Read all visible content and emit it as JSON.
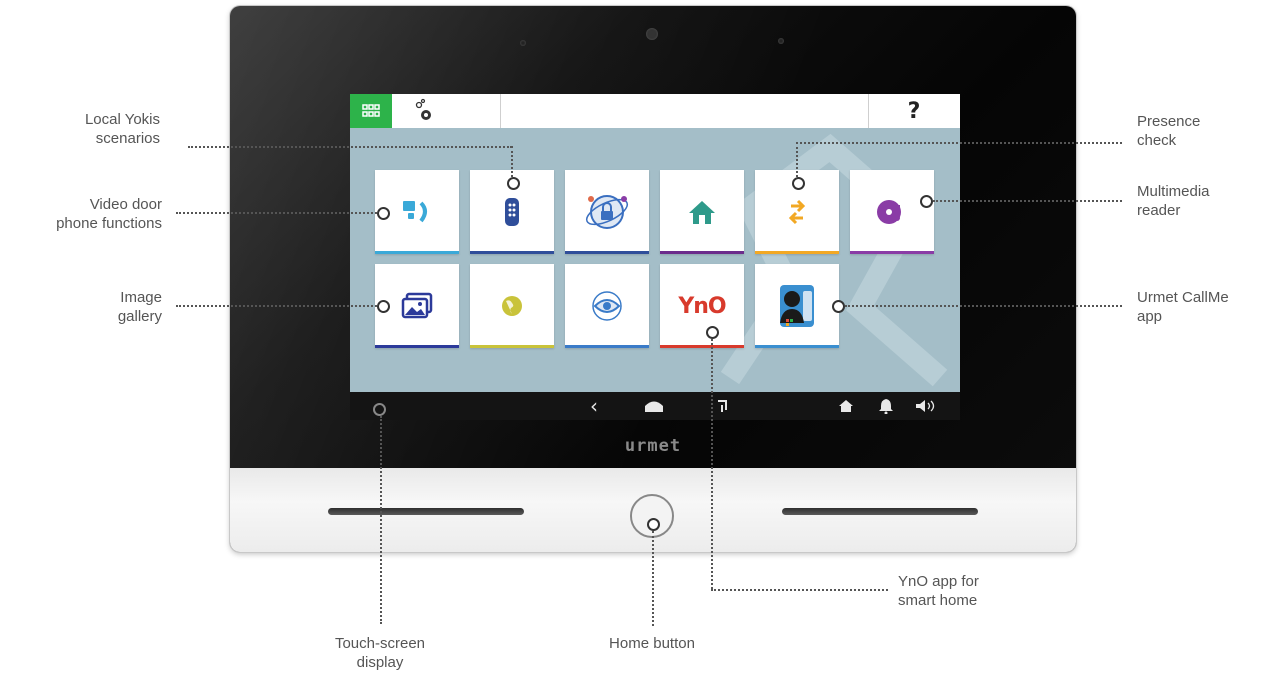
{
  "brand": "urmet",
  "screen": {
    "help_label": "?",
    "nav": {
      "back": "‹",
      "home": "⌂",
      "recent": "⌝"
    },
    "tiles": [
      {
        "name": "video-door-phone-tile",
        "icon": "door-phone-icon",
        "bar_color": "#3aa9d8"
      },
      {
        "name": "yokis-remote-tile",
        "icon": "remote-control-icon",
        "bar_color": "#2f4e9a"
      },
      {
        "name": "security-tile",
        "icon": "padlock-orbit-icon",
        "bar_color": "#2f4e9a"
      },
      {
        "name": "home-tile",
        "icon": "house-icon",
        "bar_color": "#6c2c8c"
      },
      {
        "name": "presence-check-tile",
        "icon": "arrows-exchange-icon",
        "bar_color": "#f2a824"
      },
      {
        "name": "multimedia-tile",
        "icon": "music-disc-icon",
        "bar_color": "#8a3ca6"
      },
      {
        "name": "image-gallery-tile",
        "icon": "pictures-icon",
        "bar_color": "#2c3a9a"
      },
      {
        "name": "web-tile",
        "icon": "globe-icon",
        "bar_color": "#c9c33a"
      },
      {
        "name": "camera-eye-tile",
        "icon": "eye-icon",
        "bar_color": "#3a7bc8"
      },
      {
        "name": "yno-tile",
        "icon": "yno-logo-icon",
        "bar_color": "#d83a2c",
        "text": "YnO"
      },
      {
        "name": "callme-tile",
        "icon": "callme-app-icon",
        "bar_color": "#3a8fd0"
      }
    ]
  },
  "callouts": {
    "local_yokis": "Local Yokis\nscenarios",
    "video_door": "Video door\nphone functions",
    "image_gallery": "Image\ngallery",
    "presence_check": "Presence\ncheck",
    "multimedia_reader": "Multimedia\nreader",
    "urmet_callme": "Urmet CallMe\napp",
    "yno_app": "YnO app for\nsmart home",
    "touch_screen": "Touch-screen\ndisplay",
    "home_button": "Home button"
  }
}
